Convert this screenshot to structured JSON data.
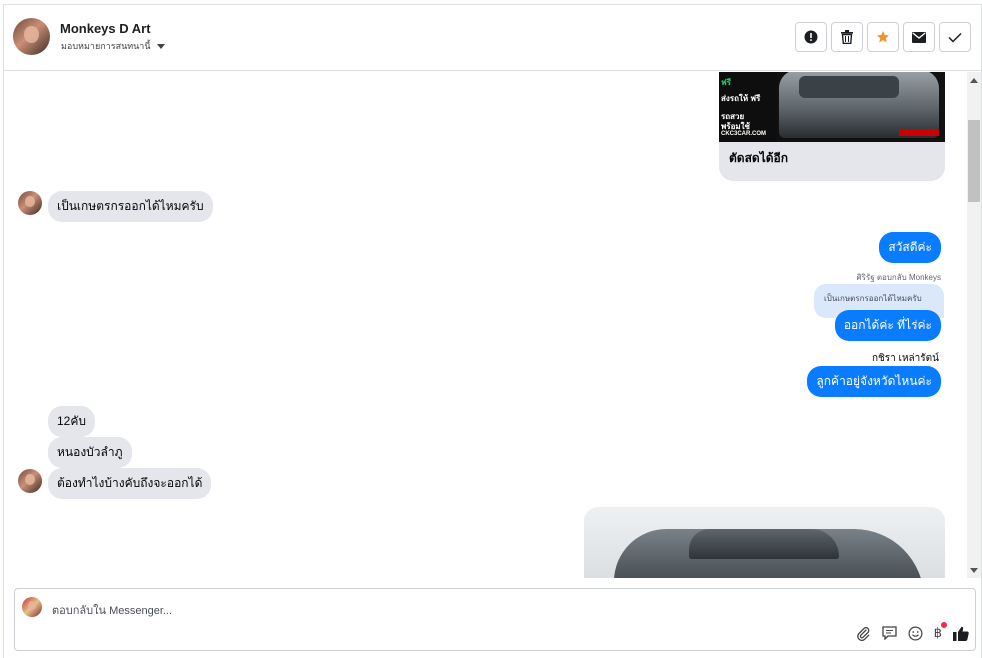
{
  "header": {
    "name": "Monkeys D Art",
    "assign_label": "มอบหมายการสนทนานี้",
    "toolbar": [
      "mark-spam-icon",
      "delete-icon",
      "star-icon",
      "mail-icon",
      "check-icon"
    ],
    "star_color": "#f0932b"
  },
  "messages": {
    "card_caption": "ตัดสดได้อีก",
    "card_tags": [
      "ฟรี",
      "ส่งรถให้ ฟรี",
      "รถสวย",
      "พร้อมใช้",
      "CKC3CAR.COM"
    ],
    "in_1": "เป็นเกษตรกรออกได้ไหมครับ",
    "out_1": "สวัสดีค่ะ",
    "reply_meta": "ศิริรัฐ ตอบกลับ Monkeys",
    "reply_quote": "เป็นเกษตรกรออกได้ไหมครับ",
    "out_2": "ออกได้ค่ะ ที่ไร่ค่ะ",
    "sender_name": "กชิรา เหล่ารัตน์",
    "out_3": "ลูกค้าอยู่จังหวัดไหนค่ะ",
    "in_2": "12คับ",
    "in_3": "หนองบัวลำภู",
    "in_4": "ต้องทำไงบ้างคับถึงจะออกได้"
  },
  "composer": {
    "placeholder": "ตอบกลับใน Messenger...",
    "tools": [
      "attach-icon",
      "saved-reply-icon",
      "emoji-icon",
      "baht-icon",
      "like-icon"
    ],
    "baht_symbol": "฿"
  },
  "colors": {
    "outgoing": "#0a7cff",
    "incoming": "#e4e6eb"
  }
}
